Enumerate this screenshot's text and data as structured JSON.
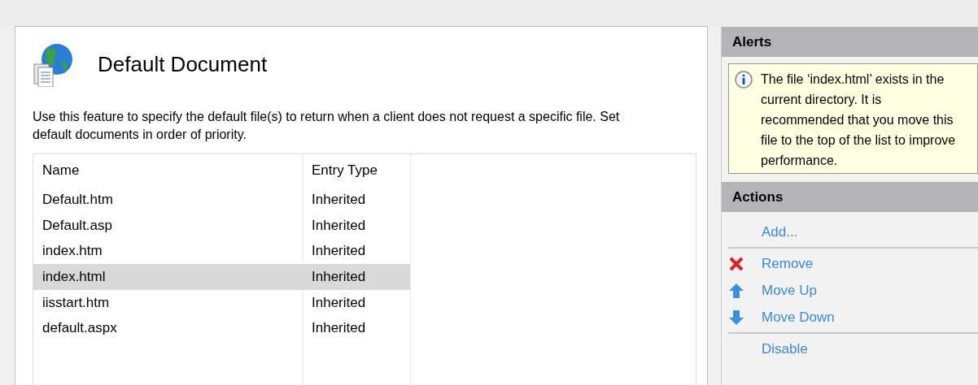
{
  "feature": {
    "title": "Default Document",
    "description": "Use this feature to specify the default file(s) to return when a client does not request a specific file. Set default documents in order of priority."
  },
  "table": {
    "columns": [
      "Name",
      "Entry Type"
    ],
    "rows": [
      {
        "name": "Default.htm",
        "entry_type": "Inherited",
        "selected": false
      },
      {
        "name": "Default.asp",
        "entry_type": "Inherited",
        "selected": false
      },
      {
        "name": "index.htm",
        "entry_type": "Inherited",
        "selected": false
      },
      {
        "name": "index.html",
        "entry_type": "Inherited",
        "selected": true
      },
      {
        "name": "iisstart.htm",
        "entry_type": "Inherited",
        "selected": false
      },
      {
        "name": "default.aspx",
        "entry_type": "Inherited",
        "selected": false
      }
    ]
  },
  "alerts": {
    "title": "Alerts",
    "message": "The file ‘index.html’ exists in the current directory. It is recommended that you move this file to the top of the list to improve performance."
  },
  "actions": {
    "title": "Actions",
    "items": [
      {
        "label": "Add...",
        "kind": "plain",
        "separator_before": false
      },
      {
        "label": "Remove",
        "kind": "remove",
        "separator_before": true
      },
      {
        "label": "Move Up",
        "kind": "up",
        "separator_before": false
      },
      {
        "label": "Move Down",
        "kind": "down",
        "separator_before": false
      },
      {
        "label": "Disable",
        "kind": "plain",
        "separator_before": true
      }
    ]
  }
}
